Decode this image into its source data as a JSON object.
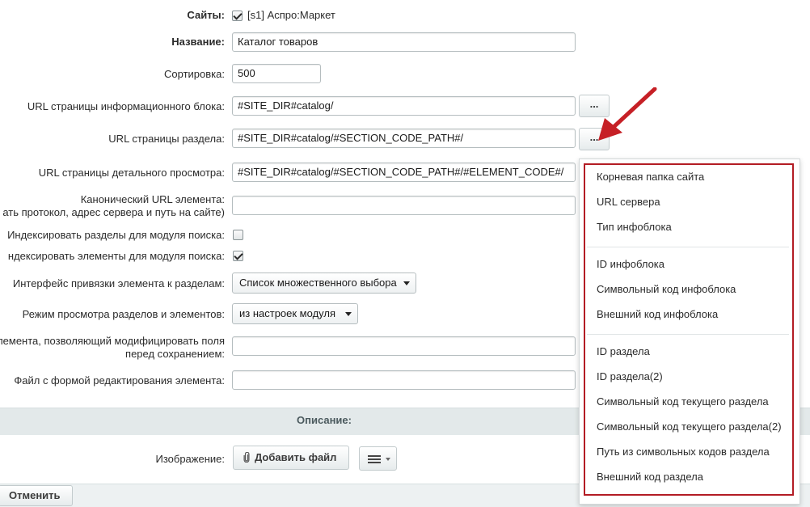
{
  "form": {
    "sites": {
      "label": "Сайты:",
      "value": "[s1] Аспро:Маркет",
      "checked": true
    },
    "name": {
      "label": "Название:",
      "value": "Каталог товаров"
    },
    "sort": {
      "label": "Сортировка:",
      "value": "500"
    },
    "iblock_url": {
      "label": "URL страницы информационного блока:",
      "value": "#SITE_DIR#catalog/",
      "button": "..."
    },
    "section_url": {
      "label": "URL страницы раздела:",
      "value": "#SITE_DIR#catalog/#SECTION_CODE_PATH#/",
      "button": "..."
    },
    "detail_url": {
      "label": "URL страницы детального просмотра:",
      "value": "#SITE_DIR#catalog/#SECTION_CODE_PATH#/#ELEMENT_CODE#/"
    },
    "canonical": {
      "label_line1": "Канонический URL элемента:",
      "label_line2": "ать протокол, адрес сервера и путь на сайте)",
      "value": ""
    },
    "index_sections": {
      "label": "Индексировать разделы для модуля поиска:",
      "checked": false
    },
    "index_elements": {
      "label": "ндексировать элементы для модуля поиска:",
      "checked": true
    },
    "binding_interface": {
      "label": "Интерфейс привязки элемента к разделам:",
      "selected": "Список множественного выбора"
    },
    "view_mode": {
      "label": "Режим просмотра разделов и элементов:",
      "selected": "из настроек модуля"
    },
    "modify_handler": {
      "label_line1": "лемента, позволяющий модифицировать поля",
      "label_line2": "перед сохранением:",
      "value": ""
    },
    "edit_form_file": {
      "label": "Файл с формой редактирования элемента:",
      "value": ""
    }
  },
  "section": {
    "title": "Описание:"
  },
  "image": {
    "label": "Изображение:",
    "add_file": "Добавить файл"
  },
  "footer": {
    "cancel": "Отменить"
  },
  "popup": {
    "groups": [
      [
        "Корневая папка сайта",
        "URL сервера",
        "Тип инфоблока"
      ],
      [
        "ID инфоблока",
        "Символьный код инфоблока",
        "Внешний код инфоблока"
      ],
      [
        "ID раздела",
        "ID раздела(2)",
        "Символьный код текущего раздела",
        "Символьный код текущего раздела(2)",
        "Путь из символьных кодов раздела",
        "Внешний код раздела"
      ]
    ]
  },
  "colors": {
    "highlight": "#b31c24",
    "section_bar": "#e3e9ea"
  },
  "icons": {
    "attach": "paperclip-icon",
    "menu": "hamburger-icon",
    "annotation": "red-arrow-icon"
  }
}
